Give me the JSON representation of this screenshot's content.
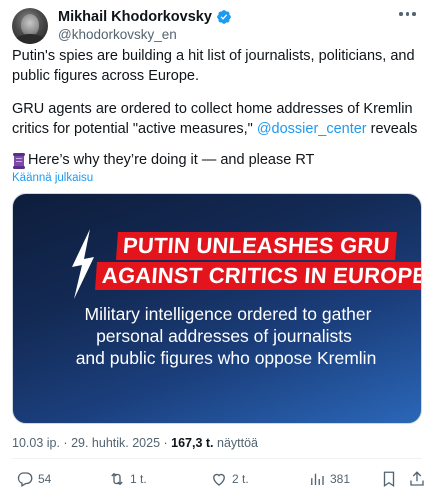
{
  "author": {
    "display_name": "Mikhail Khodorkovsky",
    "handle": "@khodorkovsky_en",
    "verified": true
  },
  "tweet": {
    "paragraph1": "Putin's spies are building a hit list of journalists, politicians, and public figures across Europe.",
    "paragraph2_before": "GRU agents are ordered to collect home addresses of Kremlin critics for potential \"active measures,\" ",
    "paragraph2_mention": "@dossier_center",
    "paragraph2_after": " reveals",
    "paragraph3": "Here’s why they’re doing it — and please RT",
    "translate_label": "Käännä julkaisu"
  },
  "media": {
    "headline_line1": "PUTIN UNLEASHES GRU",
    "headline_line2": "AGAINST CRITICS IN EUROPE",
    "subline1": "Military intelligence ordered to gather",
    "subline2": "personal addresses of journalists",
    "subline3": "and public figures who oppose Kremlin",
    "headline_color": "#e3141b"
  },
  "meta": {
    "time_date": "10.03 ip. · 29. huhtik. 2025 · ",
    "views_count": "167,3 t.",
    "views_label": " näyttöä"
  },
  "actions": {
    "replies": "54",
    "retweets": "1 t.",
    "likes": "2 t.",
    "views": "381"
  },
  "colors": {
    "accent": "#1d9bf0",
    "secondary_text": "#536471",
    "primary_text": "#0f1419"
  }
}
